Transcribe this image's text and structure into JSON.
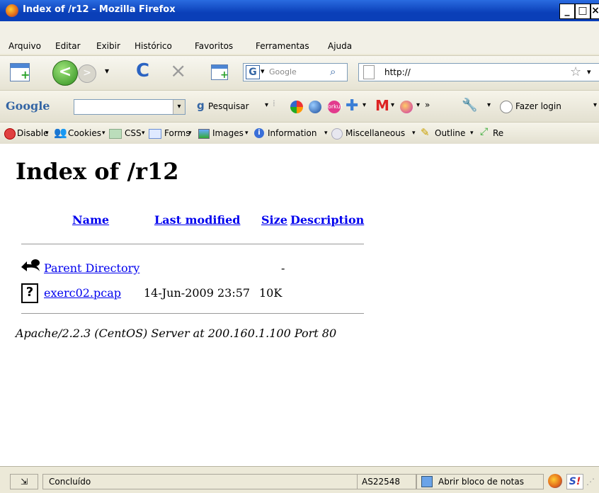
{
  "window": {
    "title": "Index of /r12 - Mozilla Firefox"
  },
  "menu": {
    "items": [
      "Arquivo",
      "Editar",
      "Exibir",
      "Histórico",
      "Favoritos",
      "Ferramentas",
      "Ajuda"
    ]
  },
  "nav": {
    "search_engine_letter": "G",
    "search_placeholder": "Google",
    "url": "http://"
  },
  "google_toolbar": {
    "logo": "Google",
    "search_label": "Pesquisar",
    "login_label": "Fazer login",
    "more": "»"
  },
  "webdev": {
    "items": [
      "Disable",
      "Cookies",
      "CSS",
      "Forms",
      "Images",
      "Information",
      "Miscellaneous",
      "Outline",
      "Re"
    ]
  },
  "page": {
    "heading": "Index of /r12",
    "columns": [
      "Name",
      "Last modified",
      "Size",
      "Description"
    ],
    "rows": [
      {
        "name": "Parent Directory",
        "modified": "",
        "size": "-",
        "icon": "back-icon"
      },
      {
        "name": "exerc02.pcap",
        "modified": "14-Jun-2009 23:57",
        "size": "10K",
        "icon": "unknown-file-icon"
      }
    ],
    "address": "Apache/2.2.3 (CentOS) Server at 200.160.1.100 Port 80"
  },
  "status": {
    "text": "Concluído",
    "as": "AS22548",
    "notepad": "Abrir bloco de notas"
  }
}
